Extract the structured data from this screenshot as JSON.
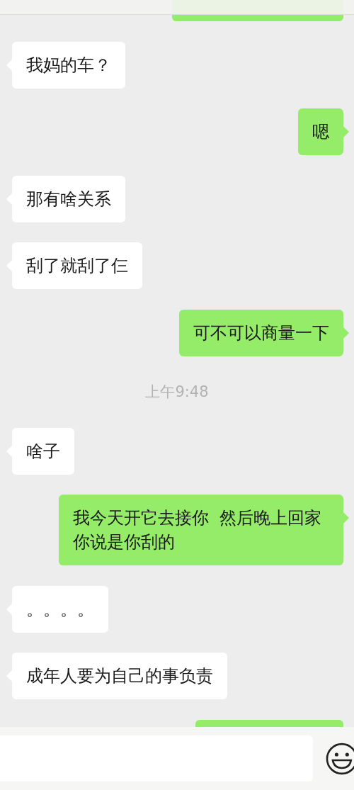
{
  "messages": [
    {
      "kind": "cut-bubble",
      "outgoing": true
    },
    {
      "kind": "bubble",
      "outgoing": false,
      "text": "我妈的车？"
    },
    {
      "kind": "bubble",
      "outgoing": true,
      "text": "嗯"
    },
    {
      "kind": "bubble",
      "outgoing": false,
      "text": "那有啥关系"
    },
    {
      "kind": "bubble",
      "outgoing": false,
      "text": "刮了就刮了仨"
    },
    {
      "kind": "bubble",
      "outgoing": true,
      "text": "可不可以商量一下"
    },
    {
      "kind": "time",
      "text": "上午9:48"
    },
    {
      "kind": "bubble",
      "outgoing": false,
      "text": "啥子"
    },
    {
      "kind": "bubble",
      "outgoing": true,
      "text": "我今天开它去接你  然后晚上回家你说是你刮的"
    },
    {
      "kind": "bubble",
      "outgoing": false,
      "text": "。。。。"
    },
    {
      "kind": "bubble",
      "outgoing": false,
      "text": "成年人要为自己的事负责"
    },
    {
      "kind": "cut-bubble",
      "outgoing": true
    }
  ]
}
